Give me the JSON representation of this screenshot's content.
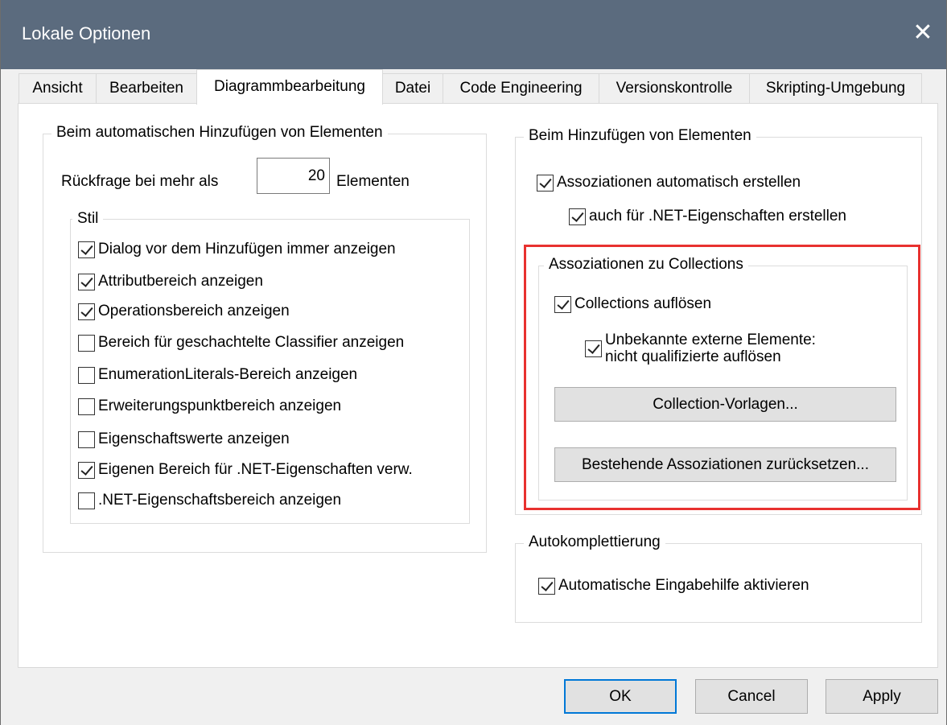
{
  "window": {
    "title": "Lokale Optionen",
    "close_symbol": "✕"
  },
  "tabs": [
    {
      "label": "Ansicht"
    },
    {
      "label": "Bearbeiten"
    },
    {
      "label": "Diagrammbearbeitung",
      "active": true
    },
    {
      "label": "Datei"
    },
    {
      "label": "Code Engineering"
    },
    {
      "label": "Versionskontrolle"
    },
    {
      "label": "Skripting-Umgebung"
    }
  ],
  "auto_add": {
    "group_label": "Beim automatischen Hinzufügen von Elementen",
    "prompt_prefix": "Rückfrage bei mehr als",
    "prompt_value": "20",
    "prompt_suffix": "Elementen",
    "style_group_label": "Stil",
    "options": [
      {
        "label": "Dialog vor dem Hinzufügen immer anzeigen",
        "checked": true
      },
      {
        "label": "Attributbereich anzeigen",
        "checked": true
      },
      {
        "label": "Operationsbereich anzeigen",
        "checked": true
      },
      {
        "label": "Bereich für geschachtelte Classifier anzeigen",
        "checked": false
      },
      {
        "label": "EnumerationLiterals-Bereich anzeigen",
        "checked": false
      },
      {
        "label": "Erweiterungspunktbereich anzeigen",
        "checked": false
      },
      {
        "label": "Eigenschaftswerte anzeigen",
        "checked": false
      },
      {
        "label": "Eigenen Bereich für .NET-Eigenschaften verw.",
        "checked": true
      },
      {
        "label": ".NET-Eigenschaftsbereich anzeigen",
        "checked": false
      }
    ]
  },
  "add_elements": {
    "group_label": "Beim Hinzufügen von Elementen",
    "create_assoc": {
      "label": "Assoziationen automatisch erstellen",
      "checked": true
    },
    "net_props": {
      "label": "auch für .NET-Eigenschaften erstellen",
      "checked": true
    },
    "collections_group_label": "Assoziationen zu Collections",
    "resolve_collections": {
      "label": "Collections auflösen",
      "checked": true
    },
    "unknown_external": {
      "label_line1": "Unbekannte externe Elemente:",
      "label_line2": "nicht qualifizierte auflösen",
      "checked": true
    },
    "collection_templates_button": "Collection-Vorlagen...",
    "reset_assoc_button": "Bestehende Assoziationen zurücksetzen..."
  },
  "autocomplete": {
    "group_label": "Autokomplettierung",
    "enable": {
      "label": "Automatische Eingabehilfe aktivieren",
      "checked": true
    }
  },
  "footer": {
    "ok": "OK",
    "cancel": "Cancel",
    "apply": "Apply"
  },
  "colors": {
    "titlebar": "#5b6b7e",
    "highlight": "#e8312f",
    "default_button_border": "#0078d7"
  }
}
